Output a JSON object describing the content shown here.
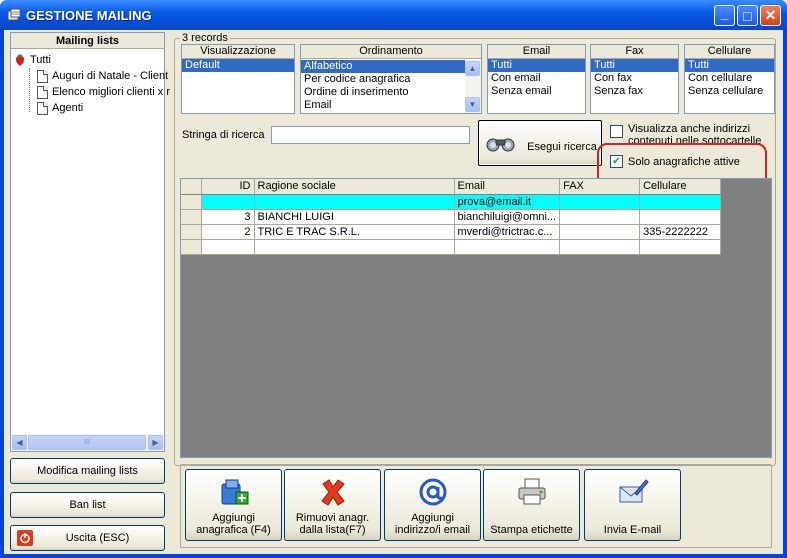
{
  "window": {
    "title": "GESTIONE MAILING",
    "min_glyph": "_",
    "max_glyph": "□",
    "close_glyph": "✕"
  },
  "mailing_lists": {
    "header": "Mailing lists",
    "items": [
      {
        "label": "Tutti"
      },
      {
        "label": "Auguri di Natale - Client"
      },
      {
        "label": "Elenco migliori clienti x r"
      },
      {
        "label": "Agenti"
      }
    ],
    "scroll_left": "◀",
    "scroll_mid": "III",
    "scroll_right": "▶"
  },
  "records_count": "3 records",
  "filters": {
    "visualizzazione": {
      "header": "Visualizzazione",
      "options": [
        "Default"
      ],
      "selected": "Default"
    },
    "ordinamento": {
      "header": "Ordinamento",
      "options": [
        "Alfabetico",
        "Per codice anagrafica",
        "Ordine di inserimento",
        "Email"
      ],
      "selected": "Alfabetico",
      "up": "▲",
      "down": "▼"
    },
    "email": {
      "header": "Email",
      "options": [
        "Tutti",
        "Con email",
        "Senza email"
      ],
      "selected": "Tutti"
    },
    "fax": {
      "header": "Fax",
      "options": [
        "Tutti",
        "Con fax",
        "Senza fax"
      ],
      "selected": "Tutti"
    },
    "cellulare": {
      "header": "Cellulare",
      "options": [
        "Tutti",
        "Con cellulare",
        "Senza cellulare"
      ],
      "selected": "Tutti"
    }
  },
  "search": {
    "label": "Stringa di ricerca",
    "value": "",
    "button": "Esegui ricerca"
  },
  "checkboxes": {
    "sottocartelle": {
      "label": "Visualizza anche indirizzi contenuti nelle sottocartelle",
      "checked": false
    },
    "solo_attive": {
      "label": "Solo anagrafiche attive",
      "checked": true,
      "check_glyph": "✔"
    }
  },
  "table": {
    "columns": [
      "ID",
      "Ragione sociale",
      "Email",
      "FAX",
      "Cellulare"
    ],
    "rows": [
      {
        "id": "",
        "ragione": "",
        "email": "prova@email.it",
        "fax": "",
        "cell": ""
      },
      {
        "id": "3",
        "ragione": "BIANCHI LUIGI",
        "email": "bianchiluigi@omni...",
        "fax": "",
        "cell": ""
      },
      {
        "id": "2",
        "ragione": "TRIC E TRAC S.R.L.",
        "email": "mverdi@trictrac.c...",
        "fax": "",
        "cell": "335-2222222"
      },
      {
        "id": "",
        "ragione": "",
        "email": "",
        "fax": "",
        "cell": ""
      }
    ]
  },
  "left_buttons": {
    "modifica": "Modifica mailing lists",
    "ban": "Ban list",
    "uscita": "Uscita (ESC)"
  },
  "bottom_buttons": {
    "aggiungi": "Aggiungi anagrafica (F4)",
    "rimuovi": "Rimuovi anagr. dalla lista(F7)",
    "aggiungi_email": "Aggiungi indirizzo/i email",
    "stampa": "Stampa etichette",
    "invia": "Invia E-mail"
  },
  "colors": {
    "titlebar": "#0a5ce8",
    "selection": "#316ac5",
    "highlight_row": "#00ffff",
    "annotation": "#e02020"
  }
}
